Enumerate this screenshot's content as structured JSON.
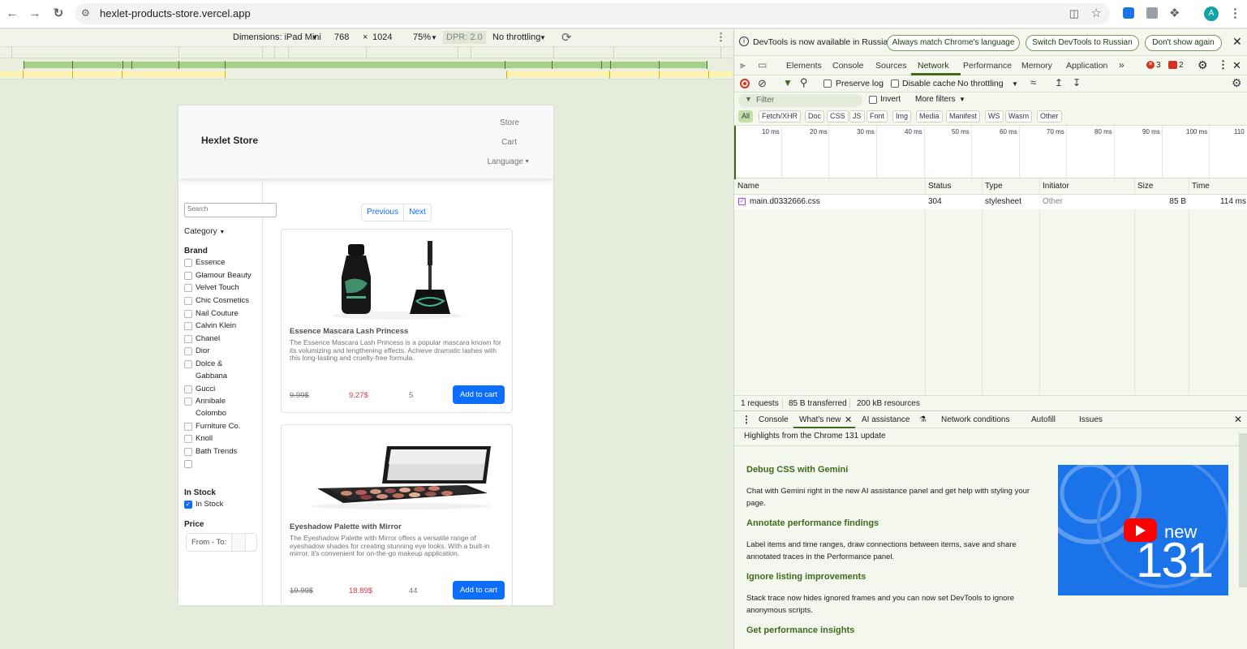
{
  "browser": {
    "url": "hexlet-products-store.vercel.app",
    "avatar_letter": "A"
  },
  "device_toolbar": {
    "dimensions_label": "Dimensions: iPad Mini",
    "width": "768",
    "times": "×",
    "height": "1024",
    "zoom": "75%",
    "dpr": "DPR: 2.0",
    "throttling": "No throttling"
  },
  "store": {
    "brand": "Hexlet Store",
    "nav": {
      "store": "Store",
      "cart": "Cart",
      "language": "Language"
    },
    "search_placeholder": "Search",
    "category": "Category",
    "brand_heading": "Brand",
    "brands": [
      "Essence",
      "Glamour Beauty",
      "Velvet Touch",
      "Chic Cosmetics",
      "Nail Couture",
      "Calvin Klein",
      "Chanel",
      "Dior",
      "Dolce &",
      "Gabbana",
      "Gucci",
      "Annibale",
      "Colombo",
      "Furniture Co.",
      "Knoll",
      "Bath Trends"
    ],
    "instock_heading": "In Stock",
    "instock_label": "In Stock",
    "price_heading": "Price",
    "price_placeholder": "From - To:",
    "pager": {
      "prev": "Previous",
      "next": "Next"
    },
    "products": [
      {
        "title": "Essence Mascara Lash Princess",
        "description": "The Essence Mascara Lash Princess is a popular mascara known for its volumizing and lengthening effects. Achieve dramatic lashes with this long-lasting and cruelty-free formula.",
        "old_price": "9.99$",
        "new_price": "9.27$",
        "quantity": "5",
        "button": "Add to cart"
      },
      {
        "title": "Eyeshadow Palette with Mirror",
        "description": "The Eyeshadow Palette with Mirror offers a versatile range of eyeshadow shades for creating stunning eye looks. With a built-in mirror, it's convenient for on-the-go makeup application.",
        "old_price": "19.99$",
        "new_price": "18.89$",
        "quantity": "44",
        "button": "Add to cart"
      }
    ]
  },
  "devtools": {
    "infobar": {
      "message": "DevTools is now available in Russian!",
      "btn_match": "Always match Chrome's language",
      "btn_switch": "Switch DevTools to Russian",
      "btn_dont": "Don't show again"
    },
    "tabs": [
      "Elements",
      "Console",
      "Sources",
      "Network",
      "Performance",
      "Memory",
      "Application"
    ],
    "more_tabs": "»",
    "error_count": "3",
    "issue_count": "2",
    "network": {
      "preserve_log": "Preserve log",
      "disable_cache": "Disable cache",
      "throttling": "No throttling",
      "filter_placeholder": "Filter",
      "invert": "Invert",
      "more_filters": "More filters",
      "types": [
        "All",
        "Fetch/XHR",
        "Doc",
        "CSS",
        "JS",
        "Font",
        "Img",
        "Media",
        "Manifest",
        "WS",
        "Wasm",
        "Other"
      ],
      "timeline_labels": [
        "10 ms",
        "20 ms",
        "30 ms",
        "40 ms",
        "50 ms",
        "60 ms",
        "70 ms",
        "80 ms",
        "90 ms",
        "100 ms",
        "110"
      ],
      "columns": {
        "name": "Name",
        "status": "Status",
        "type": "Type",
        "initiator": "Initiator",
        "size": "Size",
        "time": "Time"
      },
      "requests": [
        {
          "name": "main.d0332666.css",
          "status": "304",
          "type": "stylesheet",
          "initiator": "Other",
          "size": "85 B",
          "time": "114 ms"
        }
      ],
      "summary": {
        "requests": "1 requests",
        "transferred": "85 B transferred",
        "resources": "200 kB resources"
      }
    },
    "drawer": {
      "tabs": [
        "Console",
        "What's new",
        "AI assistance",
        "Network conditions",
        "Autofill",
        "Issues"
      ],
      "subtitle": "Highlights from the Chrome 131 update",
      "sections": [
        {
          "heading": "Debug CSS with Gemini",
          "text": "Chat with Gemini right in the new AI assistance panel and get help with styling your page."
        },
        {
          "heading": "Annotate performance findings",
          "text": "Label items and time ranges, draw connections between items, save and share annotated traces in the Performance panel."
        },
        {
          "heading": "Ignore listing improvements",
          "text": "Stack trace now hides ignored frames and you can now set DevTools to ignore anonymous scripts."
        },
        {
          "heading": "Get performance insights",
          "text": ""
        }
      ],
      "video": {
        "new_label": "new",
        "version": "131"
      }
    }
  }
}
